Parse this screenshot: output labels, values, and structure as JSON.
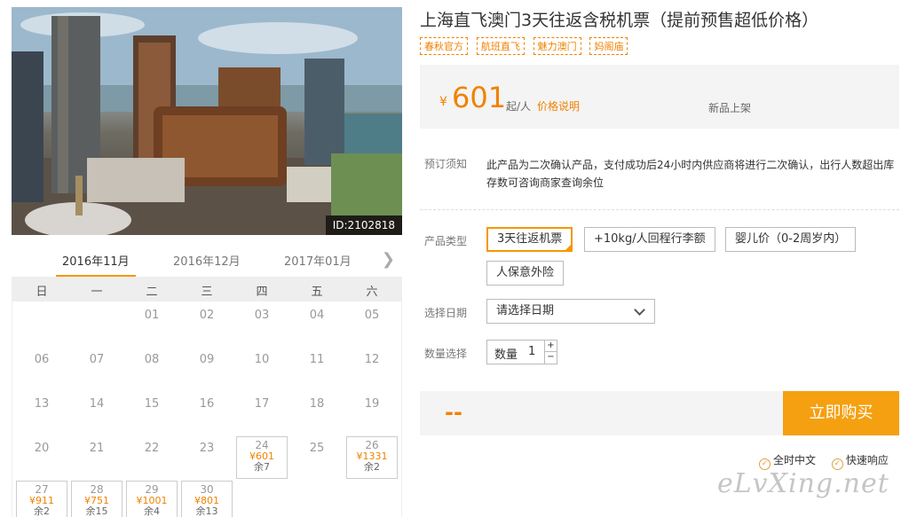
{
  "photo": {
    "id_label": "ID:2102818"
  },
  "months": {
    "tabs": [
      "2016年11月",
      "2016年12月",
      "2017年01月"
    ],
    "active_index": 0,
    "next_icon": "chevron-right-icon"
  },
  "calendar": {
    "weekdays": [
      "日",
      "一",
      "二",
      "三",
      "四",
      "五",
      "六"
    ],
    "days": [
      {
        "d": "01"
      },
      {
        "d": "02"
      },
      {
        "d": "03"
      },
      {
        "d": "04"
      },
      {
        "d": "05"
      },
      {
        "d": "06"
      },
      {
        "d": "07"
      },
      {
        "d": "08"
      },
      {
        "d": "09"
      },
      {
        "d": "10"
      },
      {
        "d": "11"
      },
      {
        "d": "12"
      },
      {
        "d": "13"
      },
      {
        "d": "14"
      },
      {
        "d": "15"
      },
      {
        "d": "16"
      },
      {
        "d": "17"
      },
      {
        "d": "18"
      },
      {
        "d": "19"
      },
      {
        "d": "20"
      },
      {
        "d": "21"
      },
      {
        "d": "22"
      },
      {
        "d": "23"
      },
      {
        "d": "24",
        "price": "¥601",
        "stock": "余7"
      },
      {
        "d": "25"
      },
      {
        "d": "26",
        "price": "¥1331",
        "stock": "余2"
      },
      {
        "d": "27",
        "price": "¥911",
        "stock": "余2"
      },
      {
        "d": "28",
        "price": "¥751",
        "stock": "余15"
      },
      {
        "d": "29",
        "price": "¥1001",
        "stock": "余4"
      },
      {
        "d": "30",
        "price": "¥801",
        "stock": "余13"
      }
    ]
  },
  "product": {
    "title": "上海直飞澳门3天往返含税机票（提前预售超低价格）",
    "tags": [
      "春秋官方",
      "航班直飞",
      "魅力澳门",
      "妈阁庙"
    ],
    "currency": "¥",
    "price": "601",
    "per_person": "起/人",
    "price_explain": "价格说明",
    "new_label": "新品上架"
  },
  "notice": {
    "label": "预订须知",
    "text": "此产品为二次确认产品，支付成功后24小时内供应商将进行二次确认，出行人数超出库存数可咨询商家查询余位"
  },
  "type_row": {
    "label": "产品类型",
    "options": [
      "3天往返机票",
      "+10kg/人回程行李额",
      "婴儿价（0-2周岁内）",
      "人保意外险"
    ],
    "selected_index": 0
  },
  "date_row": {
    "label": "选择日期",
    "placeholder": "请选择日期"
  },
  "qty_row": {
    "label": "数量选择",
    "qty_label": "数量",
    "value": "1",
    "plus": "+",
    "minus": "−"
  },
  "buy": {
    "total": "--",
    "button": "立即购买"
  },
  "badges": [
    "全时中文",
    "快速响应"
  ],
  "watermark": "eLvXing.net",
  "colors": {
    "accent": "#f39800",
    "price": "#f08200",
    "buy_button": "#f5a010"
  }
}
